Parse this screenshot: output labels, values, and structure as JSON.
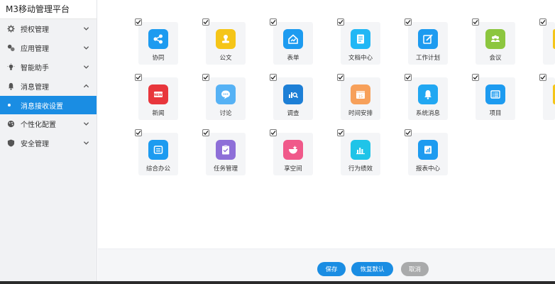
{
  "app": {
    "title": "M3移动管理平台"
  },
  "sidebar": {
    "items": [
      {
        "label": "授权管理",
        "icon": "gear-icon"
      },
      {
        "label": "应用管理",
        "icon": "apps-icon"
      },
      {
        "label": "智能助手",
        "icon": "lightbulb-icon"
      },
      {
        "label": "消息管理",
        "icon": "bell-icon",
        "expanded": true,
        "children": [
          {
            "label": "消息接收设置",
            "active": true
          }
        ]
      },
      {
        "label": "个性化配置",
        "icon": "palette-icon"
      },
      {
        "label": "安全管理",
        "icon": "shield-icon"
      }
    ]
  },
  "apps": {
    "row1": [
      {
        "label": "协同",
        "color": "#1d9bf0",
        "icon": "share-icon"
      },
      {
        "label": "公文",
        "color": "#f5c518",
        "icon": "seal-icon"
      },
      {
        "label": "表单",
        "color": "#1d9bf0",
        "icon": "form-icon"
      },
      {
        "label": "文档中心",
        "color": "#21b7f5",
        "icon": "document-icon"
      },
      {
        "label": "工作计划",
        "color": "#1d9bf0",
        "icon": "plan-icon"
      },
      {
        "label": "会议",
        "color": "#8cc63f",
        "icon": "meeting-icon"
      }
    ],
    "row2": [
      {
        "label": "新闻",
        "color": "#e8363c",
        "icon": "news-icon",
        "badge": "NEW"
      },
      {
        "label": "讨论",
        "color": "#56b2f5",
        "icon": "chat-icon"
      },
      {
        "label": "调查",
        "color": "#1d7fd6",
        "icon": "survey-icon"
      },
      {
        "label": "时间安排",
        "color": "#f7a05a",
        "icon": "calendar-icon",
        "badge": "15"
      },
      {
        "label": "系统消息",
        "color": "#21a7f2",
        "icon": "bell-icon"
      },
      {
        "label": "项目",
        "color": "#1d9bf0",
        "icon": "project-icon"
      }
    ],
    "row3": [
      {
        "label": "综合办公",
        "color": "#1d9bf0",
        "icon": "office-icon"
      },
      {
        "label": "任务管理",
        "color": "#8e6fd8",
        "icon": "task-icon"
      },
      {
        "label": "享空间",
        "color": "#f0598a",
        "icon": "space-icon"
      },
      {
        "label": "行为绩效",
        "color": "#1fc4e8",
        "icon": "performance-icon"
      },
      {
        "label": "报表中心",
        "color": "#1d9bf0",
        "icon": "report-icon"
      }
    ]
  },
  "footer": {
    "save": "保存",
    "reset": "恢复默认",
    "cancel": "取消"
  }
}
